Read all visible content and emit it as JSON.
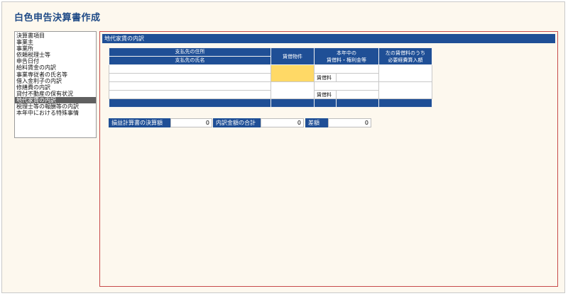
{
  "app": {
    "title": "白色申告決算書作成"
  },
  "sidebar": {
    "items": [
      {
        "label": "決算書項目"
      },
      {
        "label": "事業主"
      },
      {
        "label": "事業所"
      },
      {
        "label": "依頼税理士等"
      },
      {
        "label": "申告日付"
      },
      {
        "label": "給料賃金の内訳"
      },
      {
        "label": "事業専従者の氏名等"
      },
      {
        "label": "借入金利子の内訳"
      },
      {
        "label": "修繕費の内訳"
      },
      {
        "label": "貸付不動産の保有状況"
      },
      {
        "label": "地代家賃の内訳"
      },
      {
        "label": "税理士等の報酬等の内訳"
      },
      {
        "label": "本年中における特殊事情"
      }
    ],
    "selected_index": 10
  },
  "section": {
    "title": "地代家賃の内訳"
  },
  "table": {
    "headers": {
      "address": "支払先の住所",
      "name": "支払先の氏名",
      "property": "賃借物件",
      "rent_line1": "本年中の",
      "rent_line2": "賃借料・権利金等",
      "expense_line1": "左の賃借料のうち",
      "expense_line2": "必要経費算入額"
    },
    "rows": [
      {
        "rent_label": "賃借料"
      },
      {
        "rent_label": "賃借料"
      }
    ]
  },
  "summary": {
    "pl_label": "損益計算書の決算額",
    "pl_value": "0",
    "breakdown_label": "内訳金額の合計",
    "breakdown_value": "0",
    "diff_label": "差額",
    "diff_value": "0"
  }
}
